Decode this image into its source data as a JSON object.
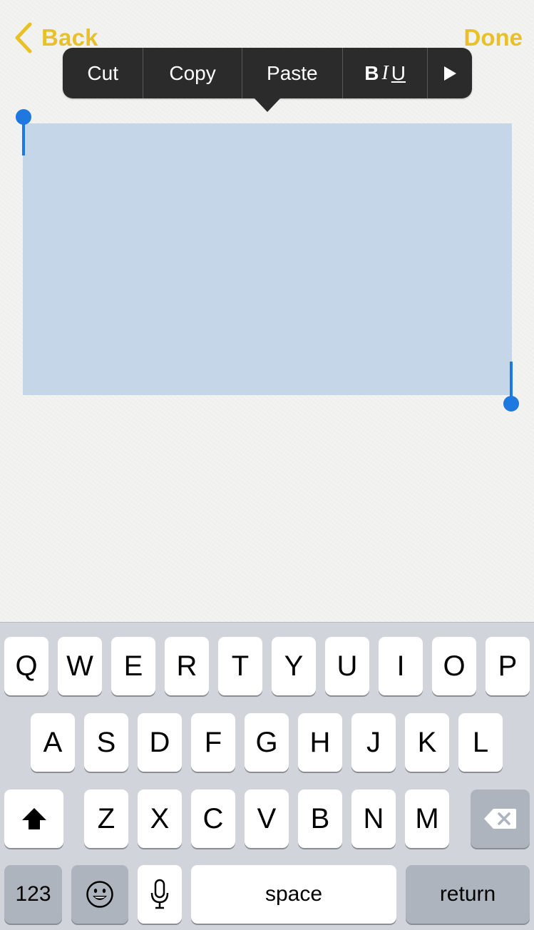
{
  "nav": {
    "back_label": "Back",
    "done_label": "Done",
    "accent": "#e8c02a"
  },
  "edit_menu": {
    "cut": "Cut",
    "copy": "Copy",
    "paste": "Paste",
    "format_bold": "B",
    "format_italic": "I",
    "format_underline": "U",
    "more_icon": "play-triangle-icon"
  },
  "selection": {
    "color": "#c5d6e8",
    "handle_color": "#1f78e0"
  },
  "keyboard": {
    "row1": [
      "Q",
      "W",
      "E",
      "R",
      "T",
      "Y",
      "U",
      "I",
      "O",
      "P"
    ],
    "row2": [
      "A",
      "S",
      "D",
      "F",
      "G",
      "H",
      "J",
      "K",
      "L"
    ],
    "row3": [
      "Z",
      "X",
      "C",
      "V",
      "B",
      "N",
      "M"
    ],
    "shift_icon": "shift-arrow-icon",
    "delete_icon": "backspace-icon",
    "numbers_label": "123",
    "emoji_icon": "emoji-face-icon",
    "mic_icon": "microphone-icon",
    "space_label": "space",
    "return_label": "return"
  }
}
